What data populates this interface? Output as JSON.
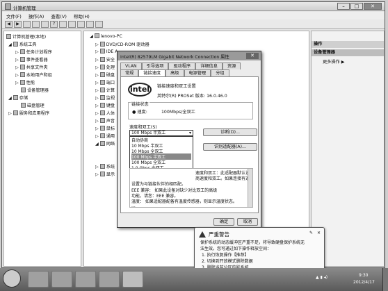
{
  "window": {
    "title": "计算机管理",
    "controls": [
      "–",
      "□",
      "✕"
    ]
  },
  "menubar": [
    "文件(F)",
    "操作(A)",
    "查看(V)",
    "帮助(H)"
  ],
  "tree": {
    "items": [
      {
        "label": "计算机管理(本地)",
        "icon": "computer-icon"
      },
      {
        "label": "系统工具",
        "icon": "tools-icon"
      },
      {
        "label": "任务计划程序",
        "icon": "clock-icon"
      },
      {
        "label": "事件查看器",
        "icon": "log-icon"
      },
      {
        "label": "共享文件夹",
        "icon": "folder-icon"
      },
      {
        "label": "本地用户和组",
        "icon": "users-icon"
      },
      {
        "label": "性能",
        "icon": "performance-icon"
      },
      {
        "label": "设备管理器",
        "icon": "device-icon"
      },
      {
        "label": "存储",
        "icon": "storage-icon"
      },
      {
        "label": "磁盘管理",
        "icon": "disk-icon"
      },
      {
        "label": "服务和应用程序",
        "icon": "services-icon"
      }
    ]
  },
  "devices": {
    "root": "lenovo-PC",
    "items": [
      "DVD/CD-ROM 驱动器",
      "IDE A",
      "安全",
      "处理",
      "磁盘",
      "端口",
      "计算",
      "监视",
      "键盘",
      "人体",
      "声音",
      "鼠标",
      "通用",
      "网络",
      "系统",
      "显示"
    ]
  },
  "actions": {
    "header": "操作",
    "section": "设备管理器",
    "more": "更多操作"
  },
  "dialog": {
    "title": "Intel(R) 82579LM Gigabit Network Connection 属性",
    "tabs_row1": [
      "VLAN",
      "引导选项",
      "驱动程序",
      "详细信息",
      "资源"
    ],
    "tabs_row2": [
      "常规",
      "链接速度",
      "高级",
      "电源管理",
      "分组"
    ],
    "logo": "intel",
    "heading": "链接速度和双工设置",
    "version": "英特尔(R) PROSet 版本: 16.0.46.0",
    "status_label": "链接状态",
    "speed_label": "速度:",
    "speed_value": "100Mbps/全双工",
    "duplex_label": "速度和双工(S)",
    "combo_value": "100 Mbps 半双工",
    "options": [
      "自动协商",
      "10 Mbps 半双工",
      "10 Mbps 全双工",
      "100 Mbps 半双工",
      "100 Mbps 全双工",
      "1.0 Gbps 全双工"
    ],
    "highlighted_index": 3,
    "diagnose_button": "诊断(D)...",
    "identify_button": "识别适配器(A)...",
    "desc_lines": [
      "速度和双工：此适配器默认设为自动检测和协",
      "商速度和双工。如果连接有速度，可将速度和双工",
      "设置为与链接伙伴的相匹配。",
      "EEE 兼容： 如果此设备对缺少对比双工的高级",
      "功能，请您：EEE 兼容。",
      "温度： 如果适配器配备有温度传感器，则显示温度状态。",
      "..."
    ],
    "ok": "确定",
    "cancel": "取消"
  },
  "warning": {
    "title": "严重警告",
    "lines": [
      "保护系统的动态缓冲区严重不足，将导致硬盘保护系统无",
      "法生效。您可通过如下操作释放空间：",
      "1. 执行恢复操作【推荐】",
      "2. 切换到开放模式删除数据",
      "3. 删除当前分区的影系统"
    ]
  },
  "taskbar": {
    "time": "9:30",
    "date": "2012/4/17"
  }
}
